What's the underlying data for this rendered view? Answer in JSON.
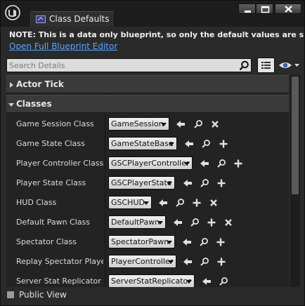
{
  "tab": {
    "title": "Class Defaults"
  },
  "window_buttons": {
    "minimize": "minimize",
    "maximize": "maximize",
    "close": "close"
  },
  "note": "NOTE: This is a data only blueprint, so only the default values are shown.  It do",
  "open_link": "Open Full Blueprint Editor",
  "search": {
    "placeholder": "Search Details",
    "value": ""
  },
  "categories": [
    {
      "label": "Actor Tick",
      "expanded": false
    },
    {
      "label": "Classes",
      "expanded": true
    }
  ],
  "rows": [
    {
      "label": "Game Session Class",
      "value": "GameSession",
      "icons": [
        "use-selected-icon",
        "browse-icon",
        "clear-icon"
      ]
    },
    {
      "label": "Game State Class",
      "value": "GameStateBase",
      "icons": [
        "use-selected-icon",
        "browse-icon",
        "add-icon"
      ]
    },
    {
      "label": "Player Controller Class",
      "value": "GSCPlayerController",
      "icons": [
        "use-selected-icon",
        "browse-icon",
        "add-icon"
      ]
    },
    {
      "label": "Player State Class",
      "value": "GSCPlayerState",
      "icons": [
        "use-selected-icon",
        "browse-icon",
        "add-icon"
      ]
    },
    {
      "label": "HUD Class",
      "value": "GSCHUD",
      "icons": [
        "use-selected-icon",
        "browse-icon",
        "add-icon",
        "clear-icon"
      ]
    },
    {
      "label": "Default Pawn Class",
      "value": "DefaultPawn",
      "icons": [
        "use-selected-icon",
        "browse-icon",
        "add-icon",
        "clear-icon"
      ]
    },
    {
      "label": "Spectator Class",
      "value": "SpectatorPawn",
      "icons": [
        "use-selected-icon",
        "browse-icon",
        "add-icon"
      ]
    },
    {
      "label": "Replay Spectator Player C",
      "value": "PlayerController",
      "icons": [
        "use-selected-icon",
        "browse-icon",
        "add-icon"
      ]
    },
    {
      "label": "Server Stat Replicator Cl",
      "value": "ServerStatReplicator",
      "icons": [
        "use-selected-icon",
        "browse-icon"
      ]
    }
  ],
  "footer": {
    "public_view_label": "Public View",
    "public_view_checked": false
  }
}
